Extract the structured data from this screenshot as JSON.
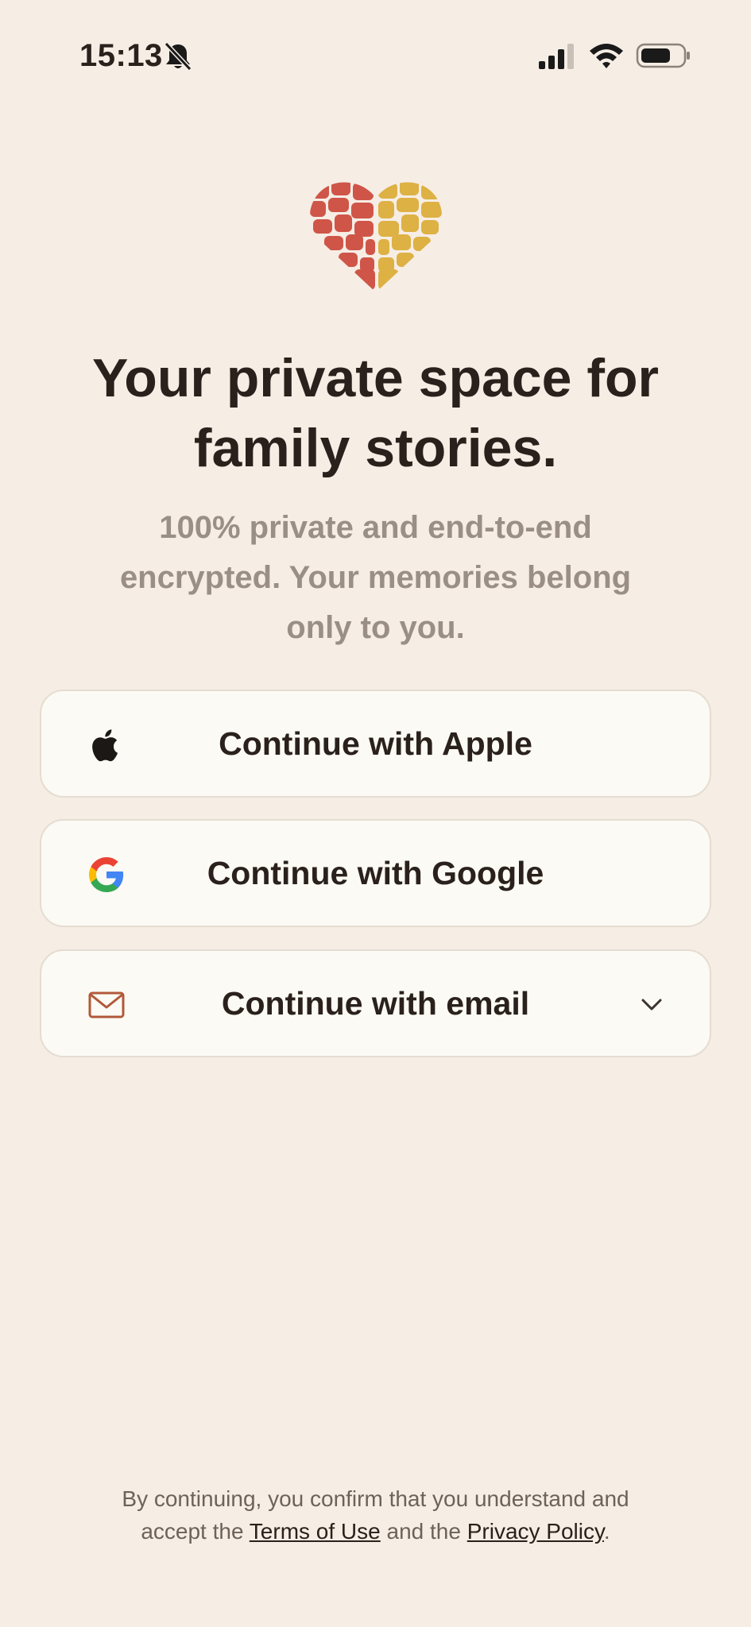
{
  "status_bar": {
    "time": "15:13",
    "icons": [
      "bell-off-icon",
      "cellular-signal-icon",
      "wifi-icon",
      "battery-icon"
    ]
  },
  "brand": {
    "logo_icon": "mosaic-heart-icon",
    "colors": {
      "heart_left": "#cf5548",
      "heart_right": "#ddb143",
      "background": "#f6ede5"
    }
  },
  "hero": {
    "headline_line1": "Your private space for",
    "headline_line2": "family stories.",
    "subtitle_line1": "100% private and end-to-end",
    "subtitle_line2": "encrypted. Your memories belong",
    "subtitle_line3": "only to you."
  },
  "auth_buttons": {
    "apple": {
      "label": "Continue with Apple",
      "icon": "apple-icon"
    },
    "google": {
      "label": "Continue with Google",
      "icon": "google-icon"
    },
    "email": {
      "label": "Continue with email",
      "icon": "mail-icon",
      "expand_icon": "chevron-down-icon"
    }
  },
  "legal": {
    "line1": "By continuing, you confirm that you understand and",
    "prefix": "accept the ",
    "terms_link": "Terms of Use",
    "middle": " and the ",
    "privacy_link": "Privacy Policy",
    "suffix": "."
  }
}
